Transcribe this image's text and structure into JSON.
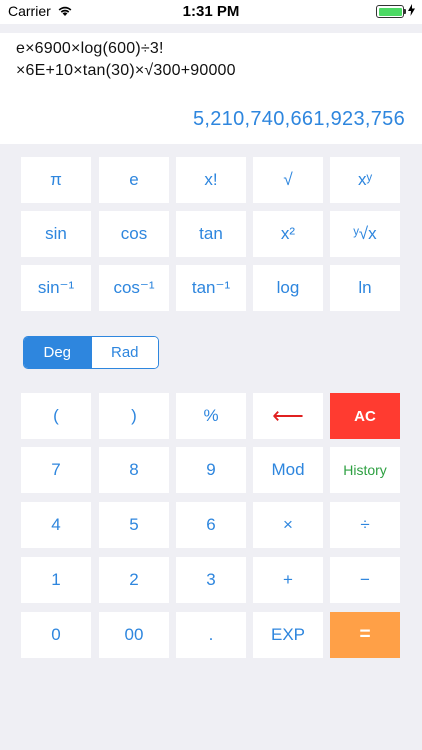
{
  "status_bar": {
    "carrier": "Carrier",
    "time": "1:31 PM"
  },
  "display": {
    "expression_line1": "e×6900×log(600)÷3!",
    "expression_line2": "×6E+10×tan(30)×√300+90000",
    "result": "5,210,740,661,923,756"
  },
  "scientific_keys": [
    [
      "π",
      "e",
      "x!",
      "√",
      "xʸ"
    ],
    [
      "sin",
      "cos",
      "tan",
      "x²",
      "ʸ√x"
    ],
    [
      "sin⁻¹",
      "cos⁻¹",
      "tan⁻¹",
      "log",
      "ln"
    ]
  ],
  "angle_mode": {
    "options": [
      "Deg",
      "Rad"
    ],
    "selected": "Deg"
  },
  "keypad": [
    [
      "(",
      ")",
      "%",
      "⟵",
      "AC"
    ],
    [
      "7",
      "8",
      "9",
      "Mod",
      "History"
    ],
    [
      "4",
      "5",
      "6",
      "×",
      "÷"
    ],
    [
      "1",
      "2",
      "3",
      "+",
      "−"
    ],
    [
      "0",
      "00",
      ".",
      "EXP",
      "="
    ]
  ],
  "colors": {
    "accent": "#2e86de",
    "clear": "#ff3b30",
    "equals": "#ffa047",
    "history": "#2ea042",
    "backspace": "#e02020"
  }
}
